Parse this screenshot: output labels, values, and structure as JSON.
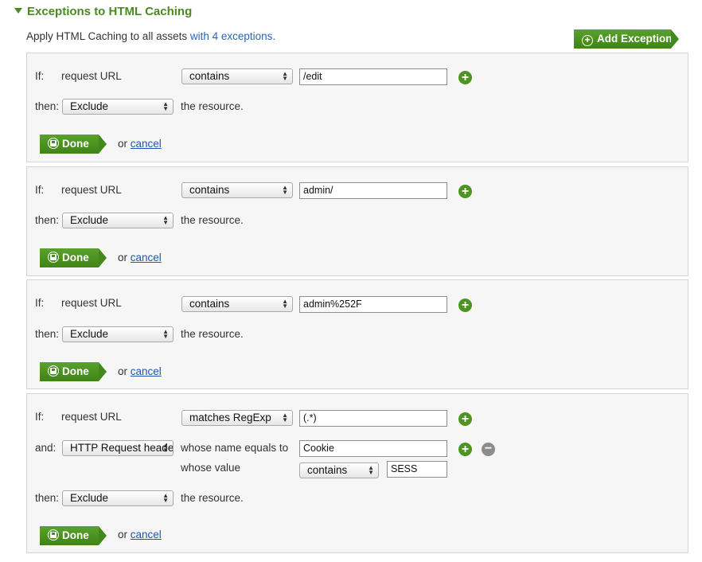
{
  "section": {
    "title": "Exceptions to HTML Caching",
    "summary_prefix": "Apply HTML Caching to all assets",
    "summary_link": "with 4 exceptions."
  },
  "add_exception": {
    "label": "Add Exception",
    "icon": "plus-circle-icon"
  },
  "labels": {
    "if": "If:",
    "then": "then:",
    "and": "and:",
    "request_url": "request URL",
    "the_resource": "the resource.",
    "whose_name_equals_to": "whose name equals to",
    "whose_value": "whose value",
    "or": "or",
    "cancel": "cancel",
    "done": "Done"
  },
  "exceptions": [
    {
      "operator": "contains",
      "value": "/edit",
      "action": "Exclude"
    },
    {
      "operator": "contains",
      "value": "admin/",
      "action": "Exclude"
    },
    {
      "operator": "contains",
      "value": "admin%252F",
      "action": "Exclude"
    },
    {
      "operator": "matches RegExp",
      "value": "(.*)",
      "action": "Exclude",
      "and_condition": {
        "type": "HTTP Request header",
        "name": "Cookie",
        "value_operator": "contains",
        "value": "SESS"
      }
    }
  ],
  "colors": {
    "accent_green": "#4a8a1f",
    "link_blue": "#2a66b5",
    "remove_gray": "#8c8c8c"
  }
}
